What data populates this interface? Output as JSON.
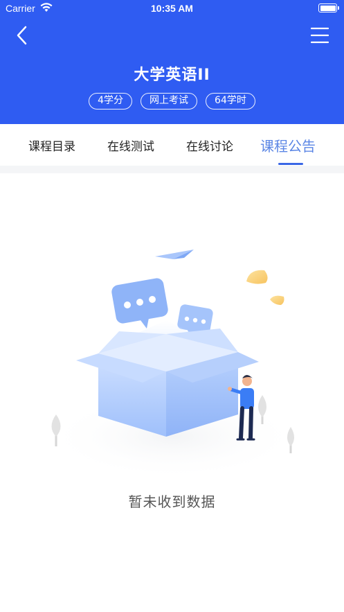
{
  "status_bar": {
    "carrier": "Carrier",
    "time": "10:35 AM"
  },
  "header": {
    "title": "大学英语II",
    "tags": [
      "4学分",
      "网上考试",
      "64学时"
    ],
    "color": "#2f5cf2"
  },
  "tabs": [
    {
      "label": "课程目录",
      "active": false
    },
    {
      "label": "在线测试",
      "active": false
    },
    {
      "label": "在线讨论",
      "active": false
    },
    {
      "label": "课程公告",
      "active": true
    }
  ],
  "empty_state": {
    "message": "暂未收到数据"
  },
  "colors": {
    "accent": "#2f5cf2",
    "active_tab": "#5b86e5"
  }
}
